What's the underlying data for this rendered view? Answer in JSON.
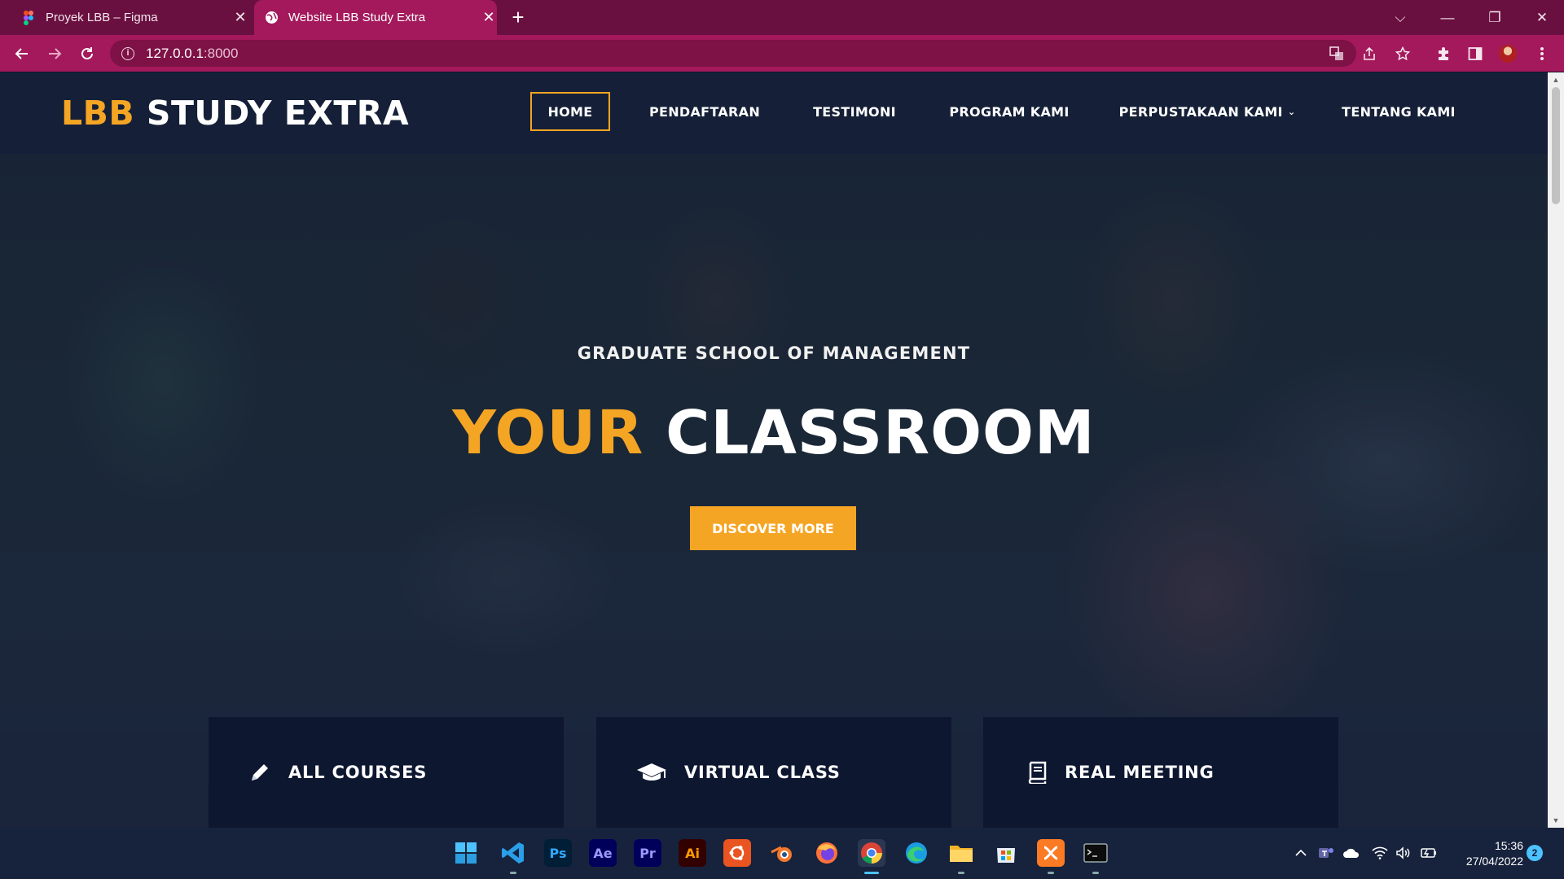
{
  "browser": {
    "tabs": [
      {
        "title": "Proyek LBB – Figma",
        "icon": "figma-icon"
      },
      {
        "title": "Website LBB Study Extra",
        "icon": "globe-icon"
      }
    ],
    "close_glyph": "✕",
    "new_tab_glyph": "+",
    "window_controls": {
      "dropdown": "⌵",
      "minimize": "—",
      "restore": "❐",
      "close": "✕"
    },
    "url_host": "127.0.0.1",
    "url_port": ":8000"
  },
  "site": {
    "logo": {
      "accent": "LBB",
      "rest": " STUDY EXTRA"
    },
    "nav": [
      "HOME",
      "PENDAFTARAN",
      "TESTIMONI",
      "PROGRAM KAMI",
      "PERPUSTAKAAN KAMI",
      "TENTANG KAMI"
    ],
    "active_nav": "HOME",
    "dropdown_caret": "⌄"
  },
  "hero": {
    "subtitle": "GRADUATE SCHOOL OF MANAGEMENT",
    "headline_accent": "YOUR",
    "headline_rest": " CLASSROOM",
    "cta": "DISCOVER MORE"
  },
  "features": [
    {
      "label": "ALL COURSES",
      "icon": "pencil-icon"
    },
    {
      "label": "VIRTUAL CLASS",
      "icon": "graduation-cap-icon"
    },
    {
      "label": "REAL MEETING",
      "icon": "book-icon"
    }
  ],
  "taskbar": {
    "apps": [
      {
        "name": "windows-start-icon",
        "label": ""
      },
      {
        "name": "vscode-icon",
        "label": ""
      },
      {
        "name": "photoshop-icon",
        "label": "Ps"
      },
      {
        "name": "after-effects-icon",
        "label": "Ae"
      },
      {
        "name": "premiere-icon",
        "label": "Pr"
      },
      {
        "name": "illustrator-icon",
        "label": "Ai"
      },
      {
        "name": "ubuntu-icon",
        "label": ""
      },
      {
        "name": "blender-icon",
        "label": ""
      },
      {
        "name": "firefox-icon",
        "label": ""
      },
      {
        "name": "chrome-icon",
        "label": ""
      },
      {
        "name": "edge-icon",
        "label": ""
      },
      {
        "name": "file-explorer-icon",
        "label": ""
      },
      {
        "name": "microsoft-store-icon",
        "label": ""
      },
      {
        "name": "xampp-icon",
        "label": ""
      },
      {
        "name": "terminal-icon",
        "label": ""
      }
    ],
    "time": "15:36",
    "date": "27/04/2022",
    "notification_count": "2"
  },
  "colors": {
    "accent": "#f5a524",
    "browser_tabbar": "#6a1040",
    "browser_toolbar": "#a3195b",
    "site_nav": "#152038",
    "feature_card": "#0e1730"
  }
}
